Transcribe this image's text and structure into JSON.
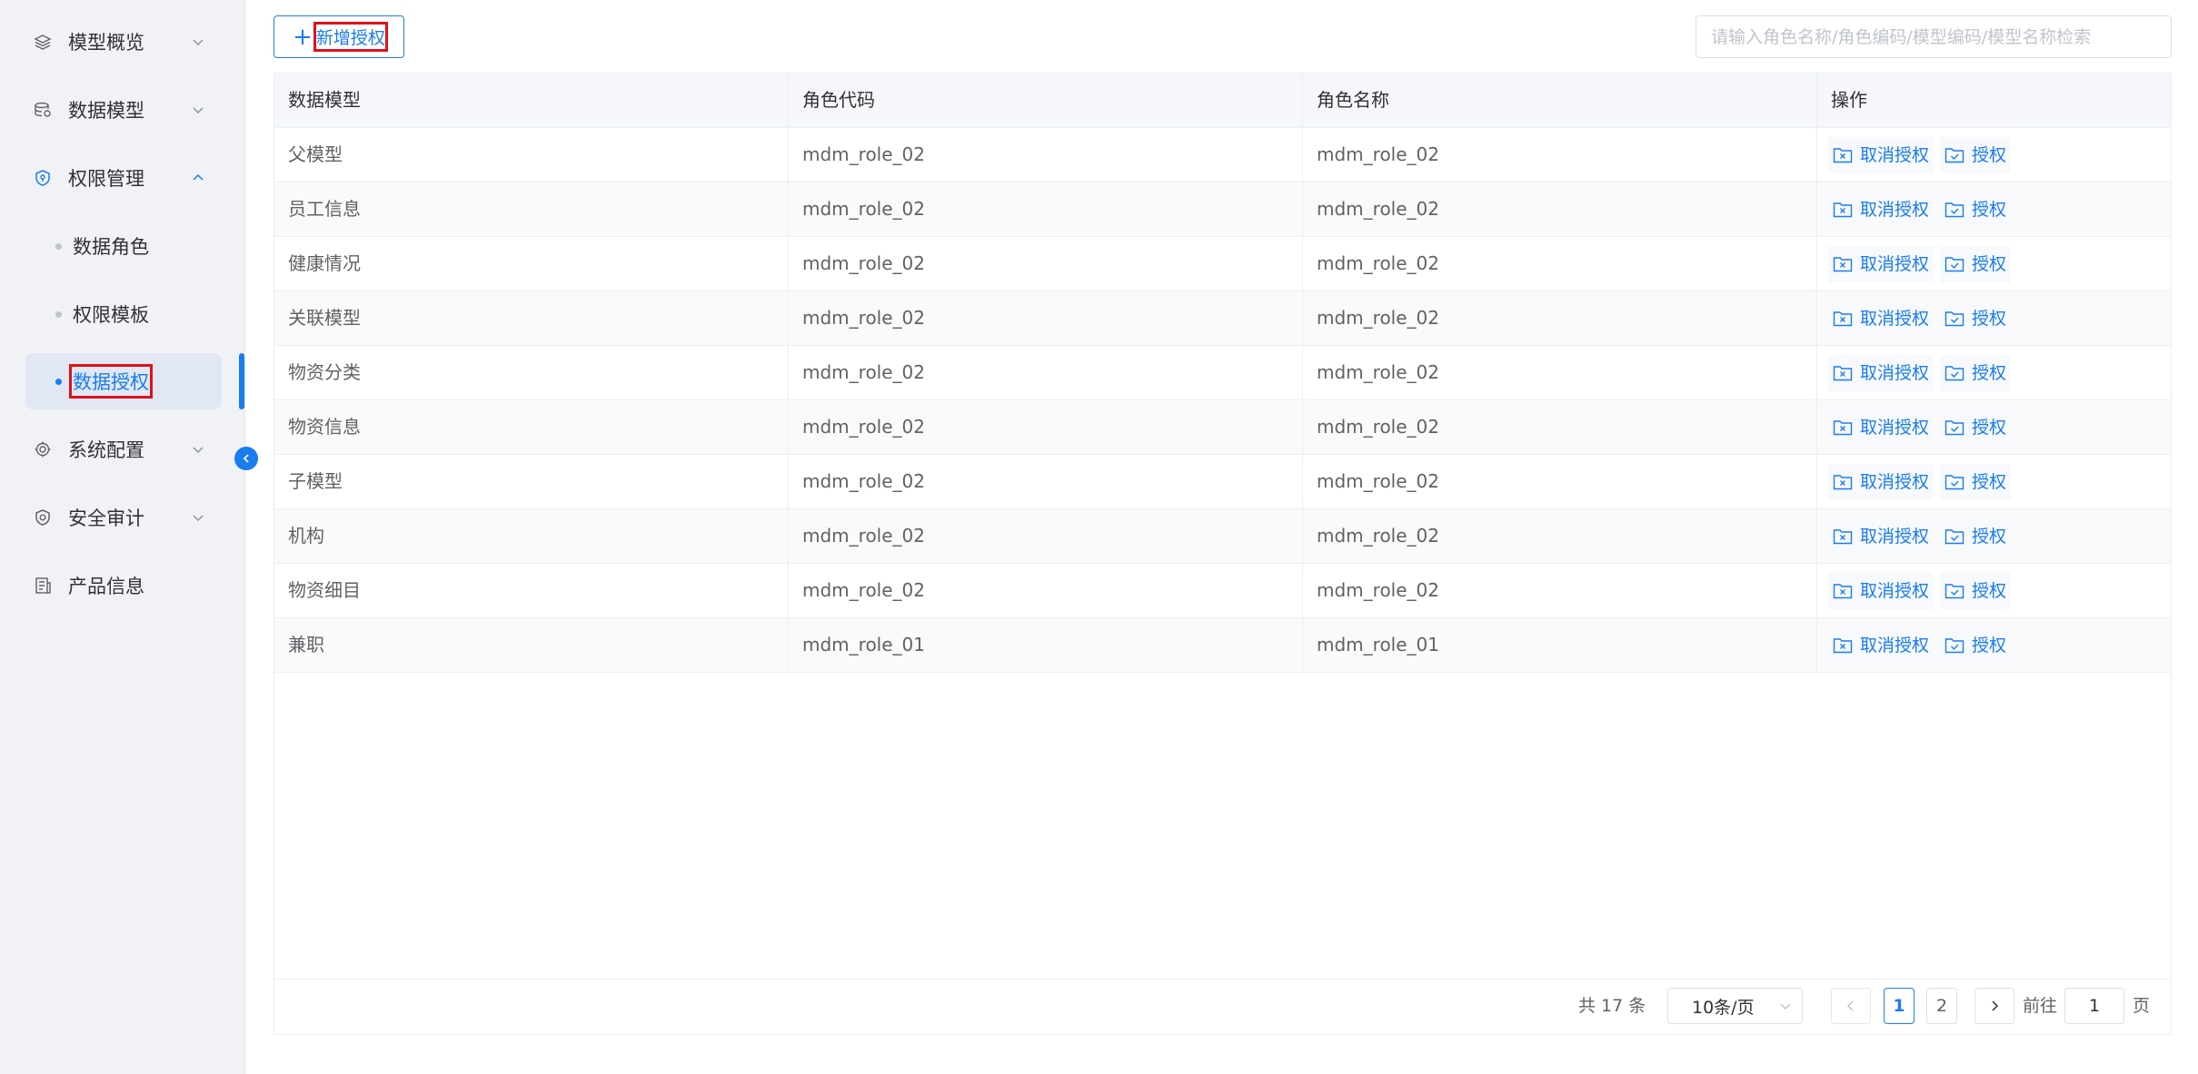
{
  "sidebar": {
    "items": [
      {
        "label": "模型概览",
        "icon": "layers-icon",
        "expanded": false
      },
      {
        "label": "数据模型",
        "icon": "database-icon",
        "expanded": false
      },
      {
        "label": "权限管理",
        "icon": "shield-icon",
        "expanded": true
      },
      {
        "label": "系统配置",
        "icon": "cpu-icon",
        "expanded": false
      },
      {
        "label": "安全审计",
        "icon": "shield-check-icon",
        "expanded": false
      },
      {
        "label": "产品信息",
        "icon": "document-icon"
      }
    ],
    "subitems": [
      {
        "label": "数据角色",
        "active": false
      },
      {
        "label": "权限模板",
        "active": false
      },
      {
        "label": "数据授权",
        "active": true
      }
    ],
    "collapse_icon": "chevron-left-icon"
  },
  "toolbar": {
    "add_label": "新增授权",
    "add_icon": "plus-icon",
    "search_placeholder": "请输入角色名称/角色编码/模型编码/模型名称检索",
    "search_value": ""
  },
  "table": {
    "headers": [
      "数据模型",
      "角色代码",
      "角色名称",
      "操作"
    ],
    "actions": {
      "cancel": "取消授权",
      "grant": "授权",
      "cancel_icon": "folder-x-icon",
      "grant_icon": "folder-check-icon"
    },
    "rows": [
      {
        "model": "父模型",
        "code": "mdm_role_02",
        "name": "mdm_role_02"
      },
      {
        "model": "员工信息",
        "code": "mdm_role_02",
        "name": "mdm_role_02"
      },
      {
        "model": "健康情况",
        "code": "mdm_role_02",
        "name": "mdm_role_02"
      },
      {
        "model": "关联模型",
        "code": "mdm_role_02",
        "name": "mdm_role_02"
      },
      {
        "model": "物资分类",
        "code": "mdm_role_02",
        "name": "mdm_role_02"
      },
      {
        "model": "物资信息",
        "code": "mdm_role_02",
        "name": "mdm_role_02"
      },
      {
        "model": "子模型",
        "code": "mdm_role_02",
        "name": "mdm_role_02"
      },
      {
        "model": "机构",
        "code": "mdm_role_02",
        "name": "mdm_role_02"
      },
      {
        "model": "物资细目",
        "code": "mdm_role_02",
        "name": "mdm_role_02"
      },
      {
        "model": "兼职",
        "code": "mdm_role_01",
        "name": "mdm_role_01"
      }
    ]
  },
  "pagination": {
    "total_text": "共 17 条",
    "page_size": "10条/页",
    "pages": [
      "1",
      "2"
    ],
    "current_page": "1",
    "goto_label": "前往",
    "goto_value": "1",
    "page_suffix": "页"
  },
  "colors": {
    "accent": "#1a7cf0",
    "highlight": "#e0101a"
  }
}
